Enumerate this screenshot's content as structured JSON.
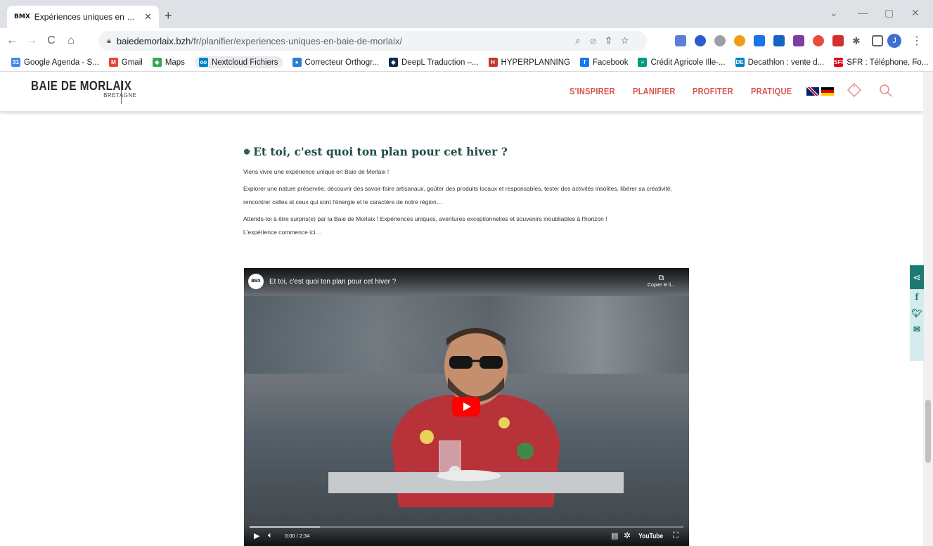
{
  "browser": {
    "tab_title": "Expériences uniques en Baie de M",
    "tab_favicon": "BMX",
    "url_host": "baiedemorlaix.bzh",
    "url_path": "/fr/planifier/experiences-uniques-en-baie-de-morlaix/",
    "profile_initial": "J",
    "bookmarks": [
      {
        "label": "Google Agenda - S...",
        "icon": "calendar-icon",
        "color": "#4285f4",
        "glyph": "31"
      },
      {
        "label": "Gmail",
        "icon": "gmail-icon",
        "color": "#ea4335",
        "glyph": "M"
      },
      {
        "label": "Maps",
        "icon": "maps-icon",
        "color": "#34a853",
        "glyph": "◆"
      },
      {
        "label": "Nextcloud Fichiers",
        "icon": "nextcloud-icon",
        "color": "#0082c9",
        "glyph": "oo"
      },
      {
        "label": "Correcteur Orthogr...",
        "icon": "spellcheck-icon",
        "color": "#2d7dd2",
        "glyph": "●"
      },
      {
        "label": "DeepL Traduction –...",
        "icon": "deepl-icon",
        "color": "#0f2b46",
        "glyph": "◆"
      },
      {
        "label": "HYPERPLANNING",
        "icon": "hyperplanning-icon",
        "color": "#c0392b",
        "glyph": "H"
      },
      {
        "label": "Facebook",
        "icon": "facebook-icon",
        "color": "#1877f2",
        "glyph": "f"
      },
      {
        "label": "Crédit Agricole Ille-...",
        "icon": "bank-icon",
        "color": "#009a7d",
        "glyph": "≡"
      },
      {
        "label": "Decathlon : vente d...",
        "icon": "decathlon-icon",
        "color": "#0082c3",
        "glyph": "DE"
      },
      {
        "label": "SFR : Téléphone, Fo...",
        "icon": "sfr-icon",
        "color": "#e2001a",
        "glyph": "SFR"
      }
    ],
    "more": "»"
  },
  "site": {
    "logo_line1": "BAIE DE MORLAIX",
    "logo_line2": "BRETAGNE",
    "nav": [
      "S'INSPIRER",
      "PLANIFIER",
      "PROFITER",
      "PRATIQUE"
    ],
    "accent": "#d9534f"
  },
  "content": {
    "heading": "Et toi, c'est quoi ton plan pour cet hiver ?",
    "p1": "Viens vivre une expérience unique en Baie de Morlaix !",
    "p2": "Explorer une nature préservée, découvrir des savoir-faire artisanaux, goûter des produits locaux et responsables, tester des activités insolites, libérer sa créativité, rencontrer celles et ceux qui sont l'énergie et le caractère de notre région…",
    "p3a": "Attends-toi à être surpris(e) par la Baie de Morlaix ! Expériences uniques, aventures exceptionnelles et souvenirs inoubliables à l'horizon !",
    "p3b": "L'expérience commence ici…"
  },
  "video": {
    "title": "Et toi, c'est quoi ton plan pour cet hiver ?",
    "copy_label": "Copier le li...",
    "time": "0:00 / 2:34",
    "brand": "YouTube"
  }
}
